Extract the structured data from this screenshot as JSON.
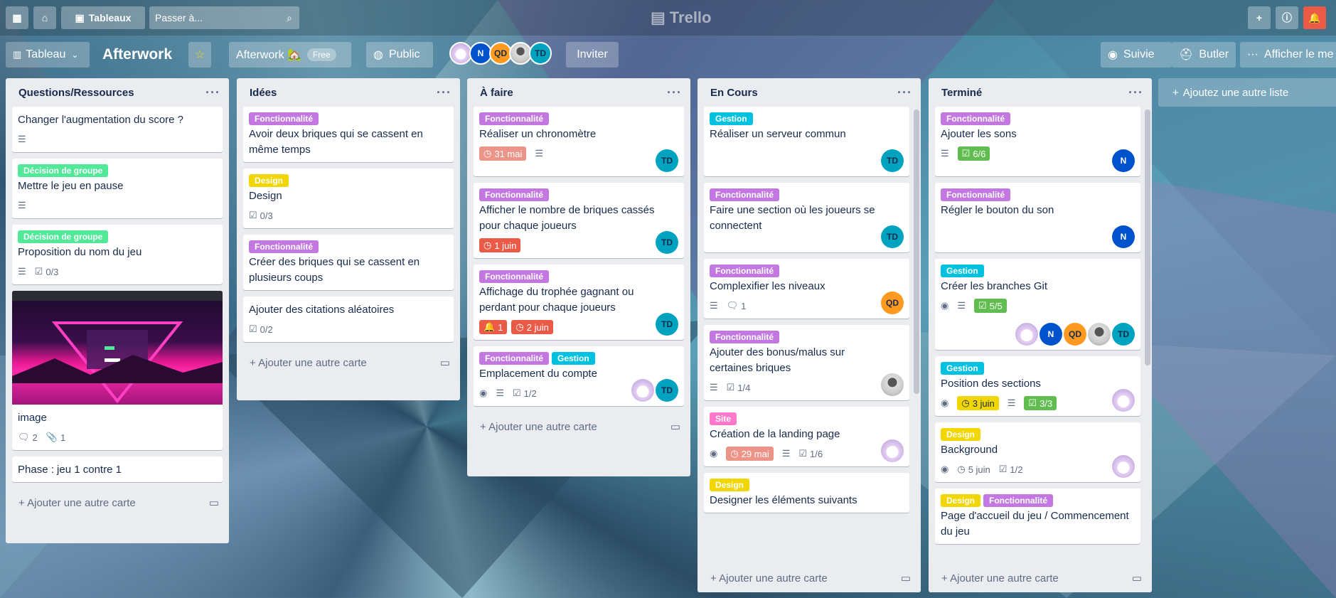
{
  "topbar": {
    "search_placeholder": "Passer à...",
    "boards_label": "Tableaux",
    "logo": "Trello"
  },
  "board": {
    "view_label": "Tableau",
    "name": "Afterwork",
    "team": "Afterwork 🏡",
    "team_badge": "Free",
    "visibility": "Public",
    "invite": "Inviter",
    "follow": "Suivie",
    "butler": "Butler",
    "menu": "Afficher le me"
  },
  "lists": [
    {
      "title": "Questions/Ressources",
      "add": "Ajouter une autre carte",
      "cards": [
        {
          "title": "Changer l'augmentation du score ?"
        },
        {
          "label": "Décision de groupe",
          "title": "Mettre le jeu en pause"
        },
        {
          "label": "Décision de groupe",
          "title": "Proposition du nom du jeu",
          "checklist": "0/3"
        },
        {
          "title": "image",
          "comments": "2",
          "attachments": "1"
        },
        {
          "title": "Phase : jeu 1 contre 1"
        }
      ]
    },
    {
      "title": "Idées",
      "add": "Ajouter une autre carte",
      "cards": [
        {
          "label": "Fonctionnalité",
          "title": "Avoir deux briques qui se cassent en même temps"
        },
        {
          "label": "Design",
          "title": "Design",
          "checklist": "0/3"
        },
        {
          "label": "Fonctionnalité",
          "title": "Créer des briques qui se cassent en plusieurs coups"
        },
        {
          "title": "Ajouter des citations aléatoires",
          "checklist": "0/2"
        }
      ]
    },
    {
      "title": "À faire",
      "add": "Ajouter une autre carte",
      "cards": [
        {
          "label": "Fonctionnalité",
          "title": "Réaliser un chronomètre",
          "due": "31 mai",
          "member": "TD"
        },
        {
          "label": "Fonctionnalité",
          "title": "Afficher le nombre de briques cassés pour chaque joueurs",
          "due": "1 juin",
          "member": "TD"
        },
        {
          "label": "Fonctionnalité",
          "title": "Affichage du trophée gagnant ou perdant pour chaque joueurs",
          "notif": "1",
          "due": "2 juin",
          "member": "TD"
        },
        {
          "label": "Fonctionnalité",
          "label2": "Gestion",
          "title": "Emplacement du compte",
          "checklist": "1/2",
          "member": "TD"
        }
      ]
    },
    {
      "title": "En Cours",
      "add": "Ajouter une autre carte",
      "cards": [
        {
          "label": "Gestion",
          "title": "Réaliser un serveur commun",
          "member": "TD"
        },
        {
          "label": "Fonctionnalité",
          "title": "Faire une section où les joueurs se connectent",
          "member": "TD"
        },
        {
          "label": "Fonctionnalité",
          "title": "Complexifier les niveaux",
          "comments": "1",
          "member": "QD"
        },
        {
          "label": "Fonctionnalité",
          "title": "Ajouter des bonus/malus sur certaines briques",
          "checklist": "1/4"
        },
        {
          "label": "Site",
          "title": "Création de la landing page",
          "due": "29 mai",
          "checklist": "1/6"
        },
        {
          "label": "Design",
          "title": "Designer les éléments suivants"
        }
      ]
    },
    {
      "title": "Terminé",
      "add": "Ajouter une autre carte",
      "cards": [
        {
          "label": "Fonctionnalité",
          "title": "Ajouter les sons",
          "checklist": "6/6",
          "member": "N"
        },
        {
          "label": "Fonctionnalité",
          "title": "Régler le bouton du son",
          "member": "N"
        },
        {
          "label": "Gestion",
          "title": "Créer les branches Git",
          "checklist": "5/5",
          "members": [
            "N",
            "QD",
            "TD"
          ]
        },
        {
          "label": "Gestion",
          "title": "Position des sections",
          "due": "3 juin",
          "checklist": "3/3"
        },
        {
          "label": "Design",
          "title": "Background",
          "due": "5 juin",
          "checklist": "1/2"
        },
        {
          "label": "Design",
          "label2": "Fonctionnalité",
          "title": "Page d'accueil du jeu / Commencement du jeu"
        }
      ]
    }
  ],
  "add_list": "Ajoutez une autre liste",
  "members": [
    "N",
    "QD",
    "TD"
  ],
  "colors": {
    "fonctionnalite": "#c377e0",
    "gestion": "#00c2e0",
    "decision": "#51e898",
    "design": "#f2d600",
    "site": "#ff78cb",
    "due_red": "#eb5a46",
    "check_green": "#61bd4f"
  }
}
